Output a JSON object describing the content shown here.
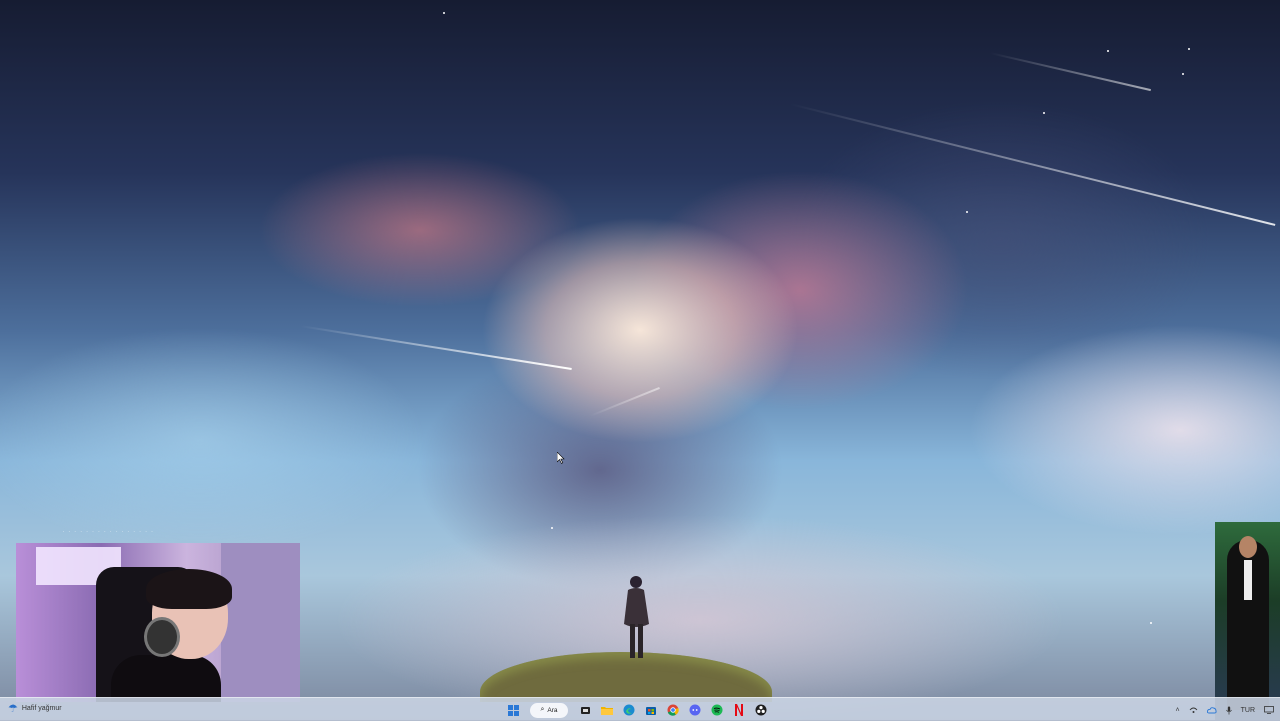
{
  "desktop": {
    "wallpaper": "sky-clouds-figure-on-cliff",
    "overlay_text": "· · · · · · · · · · · · · · · ·"
  },
  "taskbar": {
    "weather": {
      "icon": "cloud-rain-icon",
      "temperature": "",
      "label": "Hafif yağmur"
    },
    "search": {
      "icon": "search-icon",
      "label": "Ara"
    },
    "pinned_apps": [
      {
        "name": "windows-start",
        "icon": "windows-logo-icon",
        "color": "#2a78d6"
      },
      {
        "name": "task-view",
        "icon": "task-view-icon",
        "color": "#1f1f1f"
      },
      {
        "name": "file-explorer",
        "icon": "folder-icon",
        "color": "#f0b400"
      },
      {
        "name": "edge",
        "icon": "edge-icon",
        "color": "#1b8bd0"
      },
      {
        "name": "store",
        "icon": "store-icon",
        "color": "#0c5ea8"
      },
      {
        "name": "chrome",
        "icon": "chrome-icon",
        "color": "#db4437"
      },
      {
        "name": "discord",
        "icon": "discord-icon",
        "color": "#5865f2"
      },
      {
        "name": "spotify",
        "icon": "spotify-icon",
        "color": "#1db954"
      },
      {
        "name": "netflix",
        "icon": "netflix-icon",
        "color": "#e50914"
      },
      {
        "name": "obs",
        "icon": "obs-icon",
        "color": "#1e1e1e"
      }
    ],
    "tray": {
      "chevron": "˄",
      "language": "TUR"
    }
  }
}
